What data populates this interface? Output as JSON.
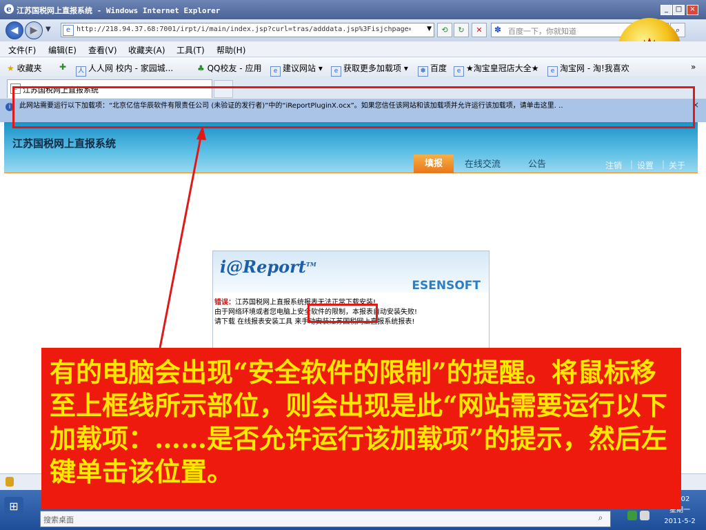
{
  "window": {
    "title": "江苏国税网上直报系统 - Windows Internet Explorer",
    "buttons": {
      "minimize": "_",
      "maximize": "□",
      "close": "×"
    }
  },
  "address_bar": {
    "url": "http://218.94.37.68:7001/irpt/i/main/index.jsp?curl=tras/adddata.jsp%3Fisjchpage=tr",
    "search_placeholder": "百度一下，你就知道"
  },
  "menu": [
    "文件(F)",
    "编辑(E)",
    "查看(V)",
    "收藏夹(A)",
    "工具(T)",
    "帮助(H)"
  ],
  "favorites": {
    "label": "收藏夹",
    "items": [
      "人人网 校内 - 家园城...",
      "QQ校友 - 应用",
      "建议网站 ▾",
      "获取更多加载项 ▾",
      "百度",
      "★淘宝皇冠店大全★",
      "淘宝网 - 淘!我喜欢"
    ],
    "overflow": "»"
  },
  "tab": {
    "label": "江苏国税网上直报系统"
  },
  "infobar": {
    "message": "此网站需要运行以下加载项：“北京亿信华辰软件有限责任公司 (未验证的发行者)”中的“iReportPluginX.ocx”。如果您信任该网站和该加载项并允许运行该加载项，请单击这里. ..",
    "close": "×"
  },
  "site": {
    "title": "江苏国税网上直报系统",
    "nav": [
      "填报",
      "在线交流",
      "公告"
    ],
    "links": [
      "注销",
      "设置",
      "关于"
    ]
  },
  "report_panel": {
    "logo": "i@Report",
    "logo_tm": "TM",
    "brand": "ESENSOFT",
    "error_label": "错误：",
    "line1": "江苏国税网上直报系统报表无法正常下载安装!",
    "line2_before": "由于网络环境或者您电脑上",
    "line2_highlight": "安全软件的限制",
    "line2_after": "，本报表自动安装失败!",
    "line3": "请下载 在线报表安装工具 来手动安装江苏国税网上直报系统报表!"
  },
  "callout": {
    "text": "有的电脑会出现“安全软件的限制”的提醒。将鼠标移至上框线所示部位，则会出现是此“网站需要运行以下加载项：……是否允许运行该加载项”的提示，然后左键单击该位置。"
  },
  "taskbar": {
    "search_placeholder": "搜索桌面",
    "clock_time": "13:02",
    "clock_weekday": "星期一",
    "clock_date": "2011-5-2"
  },
  "icons": {
    "ie": "ie-icon",
    "back": "back-arrow-icon",
    "forward": "forward-arrow-icon",
    "refresh": "refresh-icon",
    "stop": "stop-icon",
    "search": "search-icon",
    "star": "star-icon",
    "info": "info-icon",
    "shield": "shield-icon",
    "windows": "windows-start-icon",
    "emblem": "tax-emblem-icon"
  },
  "colors": {
    "highlight_red": "#e01818",
    "callout_bg": "#ef1a0e",
    "callout_text": "#ffe800",
    "nav_active": "#f08a1c"
  }
}
